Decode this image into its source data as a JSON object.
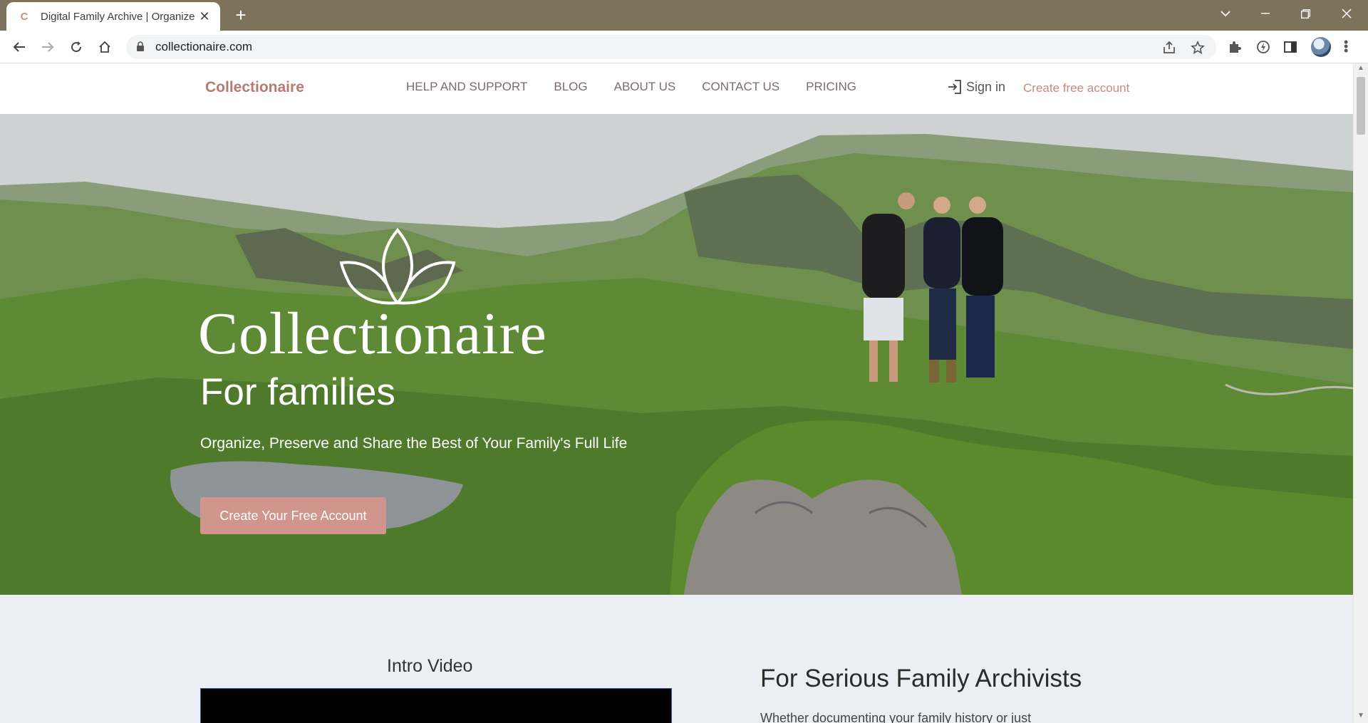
{
  "browser": {
    "tab_title": "Digital Family Archive | Organize",
    "favicon_letter": "C",
    "url": "collectionaire.com"
  },
  "site": {
    "brand": "Collectionaire",
    "nav": [
      "HELP AND SUPPORT",
      "BLOG",
      "ABOUT US",
      "CONTACT US",
      "PRICING"
    ],
    "sign_in": "Sign in",
    "create_account_link": "Create free account"
  },
  "hero": {
    "title": "Collectionaire",
    "subtitle": "For families",
    "tagline": "Organize, Preserve and Share the Best of Your Family's Full Life",
    "cta": "Create Your Free Account"
  },
  "intro": {
    "video_label": "Intro Video",
    "heading": "For Serious Family Archivists",
    "body": "Whether documenting your family history or just"
  },
  "colors": {
    "brand": "#b77a73",
    "cta": "#d0958c",
    "chrome": "#7d725b",
    "section_bg": "#eceef5"
  }
}
